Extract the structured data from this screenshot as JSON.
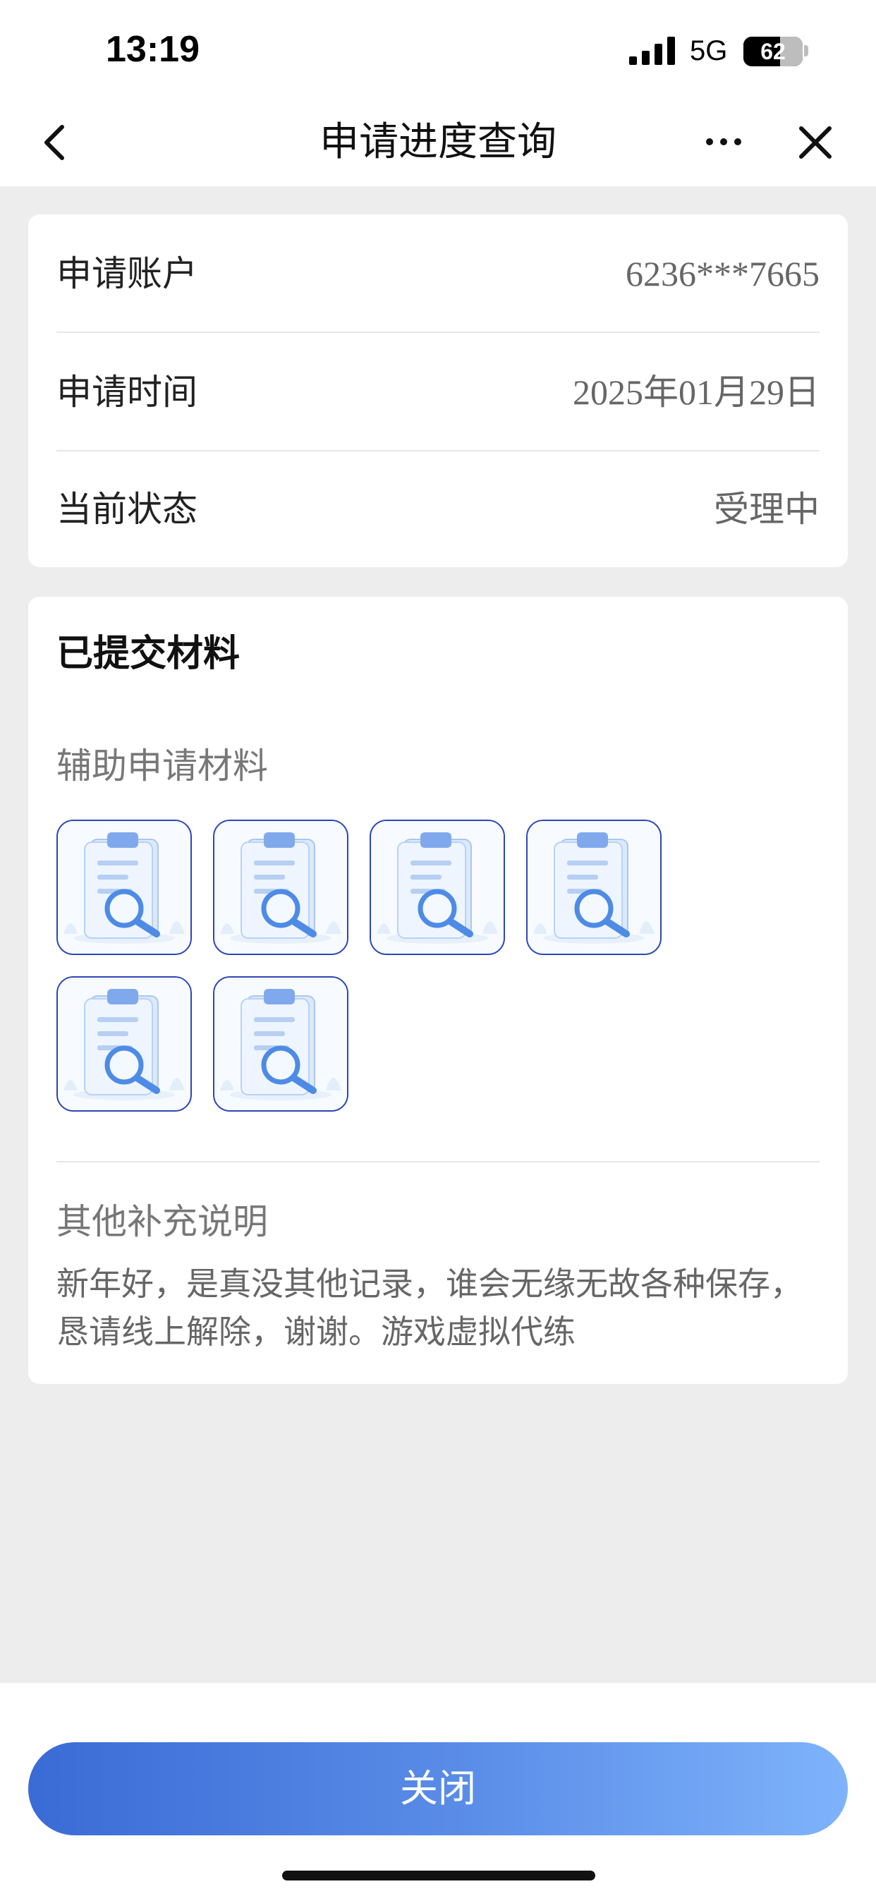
{
  "status_bar": {
    "time": "13:19",
    "network": "5G",
    "battery": "62",
    "battery_level": 0.62
  },
  "nav": {
    "title": "申请进度查询"
  },
  "info": [
    {
      "label": "申请账户",
      "value": "6236***7665"
    },
    {
      "label": "申请时间",
      "value": "2025年01月29日"
    },
    {
      "label": "当前状态",
      "value": "受理中"
    }
  ],
  "materials": {
    "title": "已提交材料",
    "subtitle": "辅助申请材料",
    "thumbnails": [
      "document-search-icon",
      "document-search-icon",
      "document-search-icon",
      "document-search-icon",
      "document-search-icon",
      "document-search-icon"
    ],
    "note_title": "其他补充说明",
    "note_text": "新年好，是真没其他记录，谁会无缘无故各种保存，恳请线上解除，谢谢。游戏虚拟代练"
  },
  "footer": {
    "close_label": "关闭"
  },
  "colors": {
    "accent_start": "#3a6bd6",
    "accent_end": "#7eb3fb",
    "thumb_border": "#2e46b8",
    "page_bg": "#ededed"
  }
}
